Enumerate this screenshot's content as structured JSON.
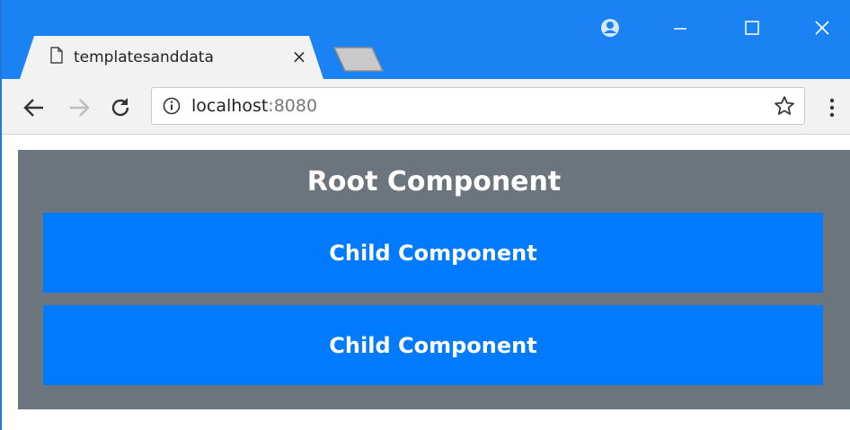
{
  "browser": {
    "tab": {
      "title": "templatesanddata",
      "close_glyph": "×"
    },
    "address_bar": {
      "host": "localhost",
      "port": ":8080"
    },
    "icons": {
      "favicon": "page-icon",
      "new_tab": "new-tab-icon",
      "profile": "profile-icon",
      "minimize": "minimize-icon",
      "maximize": "maximize-icon",
      "close": "close-icon",
      "back": "back-arrow-icon",
      "forward": "forward-arrow-icon",
      "reload": "reload-icon",
      "site_info": "info-icon",
      "bookmark": "star-icon",
      "menu": "kebab-menu-icon"
    },
    "colors": {
      "title_bar": "#1a82f2",
      "toolbar": "#f2f2f2"
    }
  },
  "page": {
    "root_component": {
      "title": "Root Component",
      "color": "#6c757d"
    },
    "child_components": [
      {
        "label": "Child Component",
        "color": "#007bff"
      },
      {
        "label": "Child Component",
        "color": "#007bff"
      }
    ]
  }
}
